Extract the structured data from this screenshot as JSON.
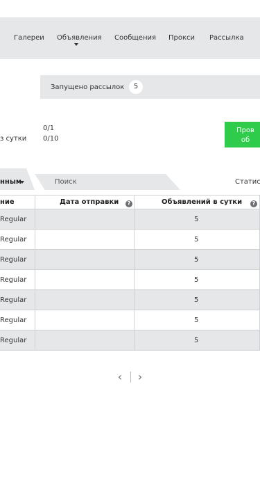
{
  "nav": {
    "items": [
      {
        "label": "Галереи"
      },
      {
        "label": "Объявления"
      },
      {
        "label": "Сообщения"
      },
      {
        "label": "Прокси"
      },
      {
        "label": "Рассылка"
      }
    ]
  },
  "status": {
    "label": "Запущено рассылок",
    "count": "5"
  },
  "stats": {
    "row1_value": "0/1",
    "row2_label": "з сутки",
    "row2_value": "0/10"
  },
  "action_button": {
    "line1": "Пров",
    "line2": "об"
  },
  "tabs": {
    "active_label": "нным",
    "search_label": "Поиск",
    "stats_label": "Статисти"
  },
  "table": {
    "headers": {
      "name": "ние",
      "send_date": "Дата отправки",
      "ads_per_day": "Объявлений в сутки"
    },
    "help_glyph": "?",
    "rows": [
      {
        "name": "Regular",
        "send_date": "",
        "ads_per_day": "5"
      },
      {
        "name": "Regular",
        "send_date": "",
        "ads_per_day": "5"
      },
      {
        "name": "Regular",
        "send_date": "",
        "ads_per_day": "5"
      },
      {
        "name": "Regular",
        "send_date": "",
        "ads_per_day": "5"
      },
      {
        "name": "Regular",
        "send_date": "",
        "ads_per_day": "5"
      },
      {
        "name": "Regular",
        "send_date": "",
        "ads_per_day": "5"
      },
      {
        "name": "Regular",
        "send_date": "",
        "ads_per_day": "5"
      }
    ]
  },
  "pager": {
    "prev": "‹",
    "next": "›"
  },
  "colors": {
    "panel_gray": "#e6e7e9",
    "accent_green": "#2ecc4a"
  }
}
